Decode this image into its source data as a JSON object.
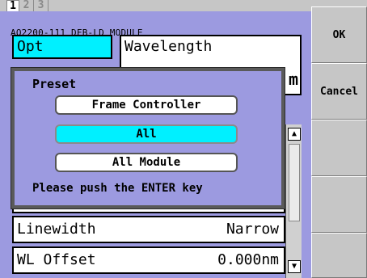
{
  "tabs": [
    {
      "label": "1",
      "active": true
    },
    {
      "label": "2",
      "active": false
    },
    {
      "label": "3",
      "active": false
    }
  ],
  "module_title": "AQ2200-111 DFB-LD MODULE",
  "opt_label": "Opt",
  "wavelength_label": "Wavelength",
  "wavelength_unit": "m",
  "rows": [
    {
      "label": "Linewidth",
      "value": "Narrow"
    },
    {
      "label": "WL Offset",
      "value": "0.000nm"
    }
  ],
  "dialog": {
    "title": "Preset",
    "options": [
      "Frame Controller",
      "All",
      "All Module"
    ],
    "selected": "All",
    "message": "Please push the ENTER key"
  },
  "softkeys": [
    "OK",
    "Cancel",
    "",
    "",
    ""
  ],
  "colors": {
    "background": "#9c9ae0",
    "selection": "#00f0ff",
    "softkey_bg": "#c6c6c6"
  },
  "icons": {
    "scroll_up": "triangle-up-icon",
    "scroll_down": "triangle-down-icon"
  }
}
